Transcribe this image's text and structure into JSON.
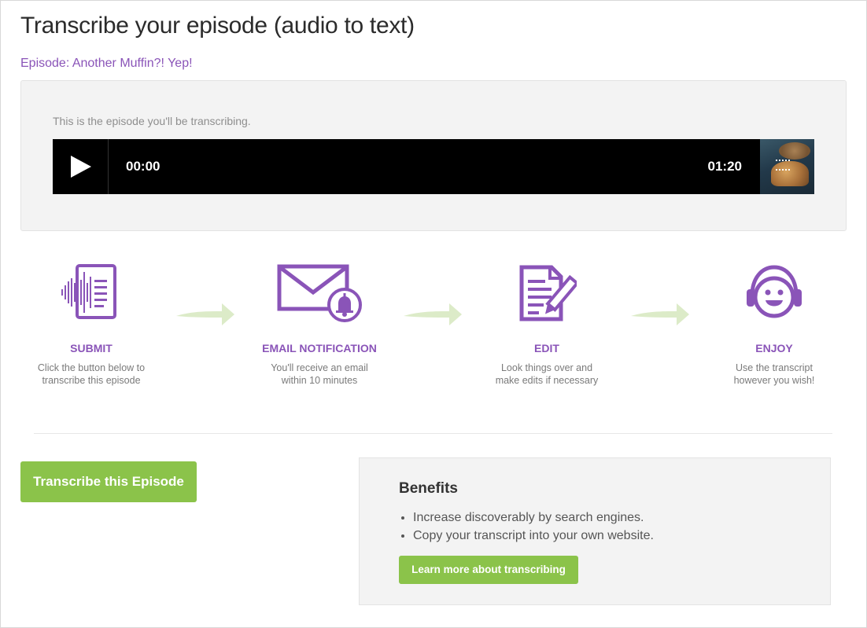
{
  "header": {
    "title": "Transcribe your episode (audio to text)",
    "episode_link": "Episode: Another Muffin?! Yep!"
  },
  "episode_panel": {
    "note": "This is the episode you'll be transcribing.",
    "player": {
      "current_time": "00:00",
      "total_time": "01:20"
    }
  },
  "steps": [
    {
      "title": "SUBMIT",
      "desc_line1": "Click the button below to",
      "desc_line2": "transcribe this episode",
      "icon": "audio-document-icon"
    },
    {
      "title": "EMAIL NOTIFICATION",
      "desc_line1": "You'll receive an email",
      "desc_line2": "within 10 minutes",
      "icon": "envelope-bell-icon"
    },
    {
      "title": "EDIT",
      "desc_line1": "Look things over and",
      "desc_line2": "make edits if necessary",
      "icon": "document-pen-icon"
    },
    {
      "title": "ENJOY",
      "desc_line1": "Use the transcript",
      "desc_line2": "however you wish!",
      "icon": "headphones-smiley-icon"
    }
  ],
  "actions": {
    "transcribe_label": "Transcribe this Episode"
  },
  "benefits": {
    "title": "Benefits",
    "items": [
      "Increase discoverably by search engines.",
      "Copy your transcript into your own website."
    ],
    "learn_more_label": "Learn more about transcribing"
  },
  "colors": {
    "accent_purple": "#8a54b8",
    "button_green": "#8bc34a",
    "arrow_green": "#dcebc8"
  }
}
